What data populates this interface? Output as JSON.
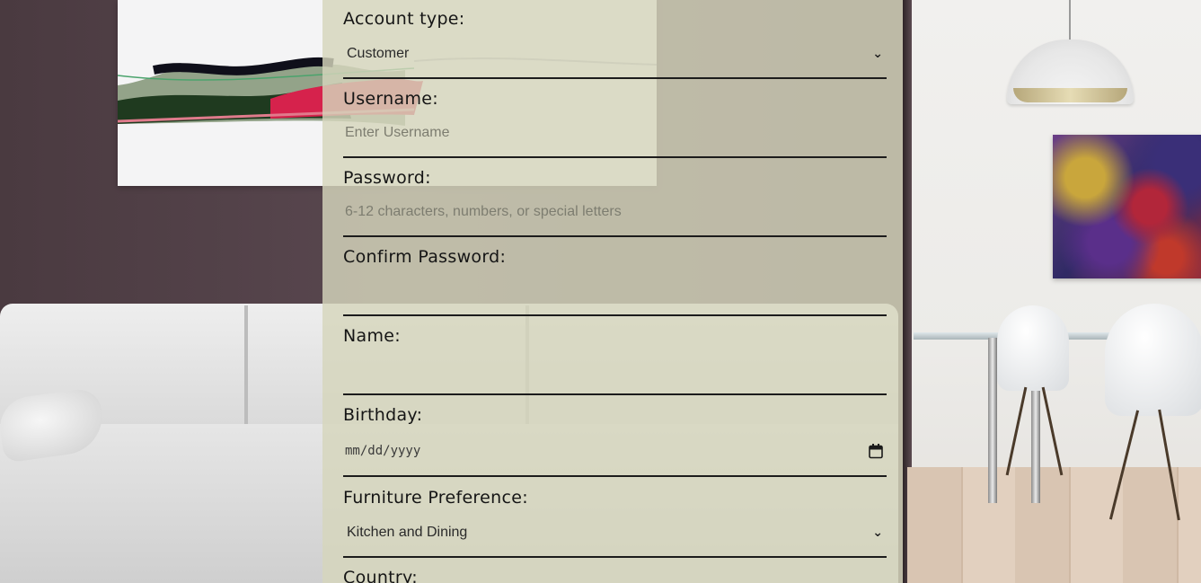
{
  "form": {
    "account_type": {
      "label": "Account type:",
      "selected": "Customer"
    },
    "username": {
      "label": "Username:",
      "placeholder": "Enter Username",
      "value": ""
    },
    "password": {
      "label": "Password:",
      "placeholder": "6-12 characters, numbers, or special letters",
      "value": ""
    },
    "confirm_password": {
      "label": "Confirm Password:",
      "value": ""
    },
    "name": {
      "label": "Name:",
      "value": ""
    },
    "birthday": {
      "label": "Birthday:",
      "placeholder": "mm/dd/yyyy"
    },
    "furniture_preference": {
      "label": "Furniture Preference:",
      "selected": "Kitchen and Dining"
    },
    "country": {
      "label": "Country:"
    }
  },
  "icons": {
    "select_chevron": "chevron-down-icon",
    "date_picker": "calendar-icon"
  },
  "colors": {
    "panel_background": "#d6d6bc",
    "underline": "#1c1c1c",
    "label_text": "#151515",
    "placeholder_text": "#7d7d70"
  }
}
